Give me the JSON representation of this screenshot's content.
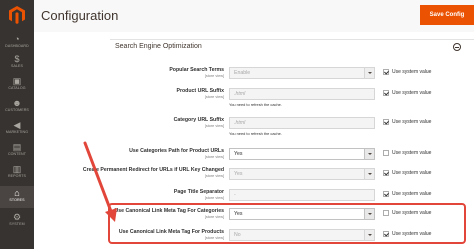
{
  "sidebar": {
    "logo": "magento-logo",
    "items": [
      {
        "label": "DASHBOARD",
        "icon": "dashboard-icon"
      },
      {
        "label": "SALES",
        "icon": "dollar-icon"
      },
      {
        "label": "CATALOG",
        "icon": "catalog-icon"
      },
      {
        "label": "CUSTOMERS",
        "icon": "customers-icon"
      },
      {
        "label": "MARKETING",
        "icon": "megaphone-icon"
      },
      {
        "label": "CONTENT",
        "icon": "content-icon"
      },
      {
        "label": "REPORTS",
        "icon": "bar-chart-icon"
      },
      {
        "label": "STORES",
        "icon": "store-icon"
      },
      {
        "label": "SYSTEM",
        "icon": "gear-icon"
      }
    ]
  },
  "header": {
    "title": "Configuration",
    "save_label": "Save Config"
  },
  "section": {
    "title": "Search Engine Optimization"
  },
  "rows": [
    {
      "label": "Popular Search Terms",
      "scope": "[store view]",
      "value": "Enable",
      "disabled": true,
      "type": "select",
      "system_value": true,
      "note": ""
    },
    {
      "label": "Product URL Suffix",
      "scope": "[store view]",
      "value": ".html",
      "disabled": true,
      "type": "text",
      "system_value": true,
      "note": "You need to refresh the cache."
    },
    {
      "label": "Category URL Suffix",
      "scope": "[store view]",
      "value": ".html",
      "disabled": true,
      "type": "text",
      "system_value": true,
      "note": "You need to refresh the cache."
    },
    {
      "label": "Use Categories Path for Product URLs",
      "scope": "[store view]",
      "value": "Yes",
      "disabled": false,
      "type": "select",
      "system_value": false,
      "note": ""
    },
    {
      "label": "Create Permanent Redirect for URLs if URL Key Changed",
      "scope": "[store view]",
      "value": "Yes",
      "disabled": true,
      "type": "select",
      "system_value": true,
      "note": ""
    },
    {
      "label": "Page Title Separator",
      "scope": "[store view]",
      "value": "-",
      "disabled": true,
      "type": "text",
      "system_value": true,
      "note": ""
    },
    {
      "label": "Use Canonical Link Meta Tag For Categories",
      "scope": "[store view]",
      "value": "Yes",
      "disabled": false,
      "type": "select",
      "system_value": false,
      "note": ""
    },
    {
      "label": "Use Canonical Link Meta Tag For Products",
      "scope": "[store view]",
      "value": "No",
      "disabled": true,
      "type": "select",
      "system_value": true,
      "note": ""
    }
  ],
  "system_value_label": "Use system value",
  "colors": {
    "sidebar_bg": "#373330",
    "accent": "#eb5202",
    "highlight": "#e2463a"
  }
}
